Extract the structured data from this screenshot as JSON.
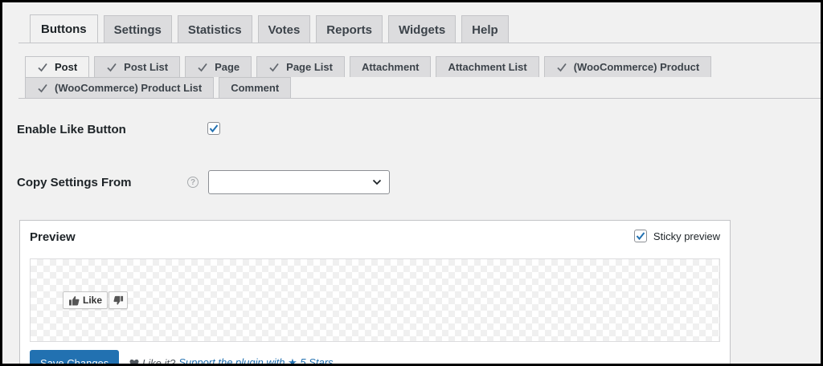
{
  "main_tabs": [
    "Buttons",
    "Settings",
    "Statistics",
    "Votes",
    "Reports",
    "Widgets",
    "Help"
  ],
  "sub_tabs_row1": [
    {
      "label": "Post",
      "checked": true
    },
    {
      "label": "Post List",
      "checked": true
    },
    {
      "label": "Page",
      "checked": true
    },
    {
      "label": "Page List",
      "checked": true
    },
    {
      "label": "Attachment",
      "checked": false
    },
    {
      "label": "Attachment List",
      "checked": false
    },
    {
      "label": "(WooCommerce) Product",
      "checked": true
    }
  ],
  "sub_tabs_row2": [
    {
      "label": "(WooCommerce) Product List",
      "checked": true
    },
    {
      "label": "Comment",
      "checked": false
    }
  ],
  "form": {
    "enable_like_label": "Enable Like Button",
    "copy_settings_label": "Copy Settings From",
    "help_icon": "?"
  },
  "preview": {
    "title": "Preview",
    "sticky_label": "Sticky preview",
    "like_label": "Like"
  },
  "footer": {
    "save_label": "Save Changes",
    "like_it": "Like it?",
    "support_link": "Support the plugin with ★ 5 Stars"
  },
  "colors": {
    "accent": "#2271b1",
    "check": "#2271b1"
  }
}
